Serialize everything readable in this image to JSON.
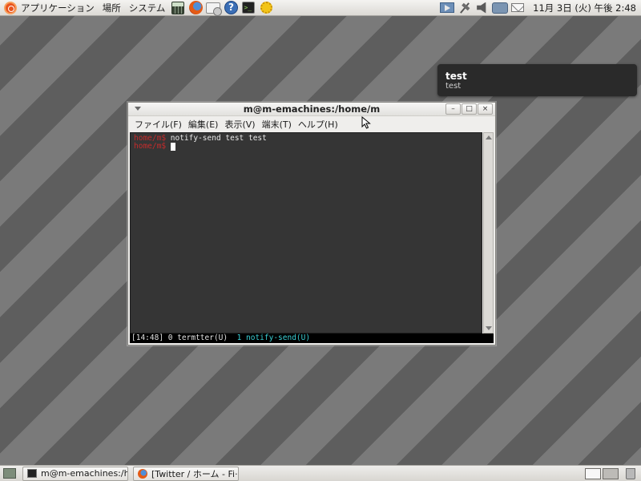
{
  "top_panel": {
    "menus": [
      "アプリケーション",
      "場所",
      "システム"
    ],
    "launchers": [
      "calculator-icon",
      "firefox-icon",
      "mail-icon",
      "help-icon",
      "terminal-icon",
      "sun-icon"
    ],
    "tray": [
      "media-icon",
      "network-icon",
      "volume-icon",
      "messaging-icon",
      "envelope-icon"
    ],
    "clock": "11月 3日 (火) 午後 2:48"
  },
  "notification": {
    "title": "test",
    "body": "test"
  },
  "window": {
    "title": "m@m-emachines:/home/m",
    "buttons": [
      "–",
      "□",
      "×"
    ],
    "menubar": [
      "ファイル(F)",
      "編集(E)",
      "表示(V)",
      "端末(T)",
      "ヘルプ(H)"
    ],
    "terminal": {
      "line1_prompt": "home/m$ ",
      "line1_command": "notify-send test test",
      "line2_prompt": "home/m$ "
    },
    "statusbar": {
      "inactive": "[14:48] 0 termtter(U)  ",
      "active": "1 notify-send(U)"
    }
  },
  "bottom_panel": {
    "tasks": [
      {
        "label": "m@m-emachines:/ho···",
        "icon": "terminal-icon"
      },
      {
        "label": "[Twitter / ホーム - Fi···",
        "icon": "firefox-icon"
      }
    ]
  },
  "colors": {
    "prompt": "#c62b2b",
    "terminal_bg": "#353535",
    "active_window": "#3ad0d6",
    "notification_bg": "#2a2a2a"
  }
}
